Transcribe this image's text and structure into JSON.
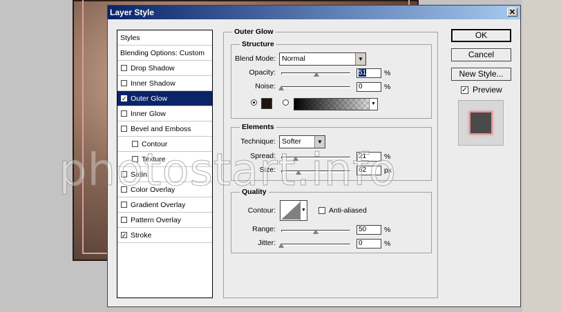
{
  "dialog": {
    "title": "Layer Style",
    "close_glyph": "✕"
  },
  "watermark": "photostart.info",
  "styles_list": [
    {
      "label": "Styles",
      "checkbox": false,
      "checked": false,
      "indent": 0,
      "selected": false
    },
    {
      "label": "Blending Options: Custom",
      "checkbox": false,
      "checked": false,
      "indent": 0,
      "selected": false
    },
    {
      "label": "Drop Shadow",
      "checkbox": true,
      "checked": false,
      "indent": 0,
      "selected": false
    },
    {
      "label": "Inner Shadow",
      "checkbox": true,
      "checked": false,
      "indent": 0,
      "selected": false
    },
    {
      "label": "Outer Glow",
      "checkbox": true,
      "checked": true,
      "indent": 0,
      "selected": true
    },
    {
      "label": "Inner Glow",
      "checkbox": true,
      "checked": false,
      "indent": 0,
      "selected": false
    },
    {
      "label": "Bevel and Emboss",
      "checkbox": true,
      "checked": false,
      "indent": 0,
      "selected": false
    },
    {
      "label": "Contour",
      "checkbox": true,
      "checked": false,
      "indent": 1,
      "selected": false
    },
    {
      "label": "Texture",
      "checkbox": true,
      "checked": false,
      "indent": 1,
      "selected": false
    },
    {
      "label": "Satin",
      "checkbox": true,
      "checked": false,
      "indent": 0,
      "selected": false
    },
    {
      "label": "Color Overlay",
      "checkbox": true,
      "checked": false,
      "indent": 0,
      "selected": false
    },
    {
      "label": "Gradient Overlay",
      "checkbox": true,
      "checked": false,
      "indent": 0,
      "selected": false
    },
    {
      "label": "Pattern Overlay",
      "checkbox": true,
      "checked": false,
      "indent": 0,
      "selected": false
    },
    {
      "label": "Stroke",
      "checkbox": true,
      "checked": true,
      "indent": 0,
      "selected": false
    }
  ],
  "outer_glow": {
    "title": "Outer Glow",
    "structure": {
      "title": "Structure",
      "blend_mode_label": "Blend Mode:",
      "blend_mode_value": "Normal",
      "opacity_label": "Opacity:",
      "opacity_value": "51",
      "noise_label": "Noise:",
      "noise_value": "0",
      "unit": "%",
      "glow_color": "#1e1410"
    },
    "elements": {
      "title": "Elements",
      "technique_label": "Technique:",
      "technique_value": "Softer",
      "spread_label": "Spread:",
      "spread_value": "21",
      "size_label": "Size:",
      "size_value": "62",
      "spread_unit": "%",
      "size_unit": "px"
    },
    "quality": {
      "title": "Quality",
      "contour_label": "Contour:",
      "antialiased_label": "Anti-aliased",
      "range_label": "Range:",
      "range_value": "50",
      "jitter_label": "Jitter:",
      "jitter_value": "0",
      "unit": "%"
    }
  },
  "buttons": {
    "ok": "OK",
    "cancel": "Cancel",
    "new_style": "New Style...",
    "preview_label": "Preview",
    "preview_checked": true
  },
  "colors": {
    "title_bar": "#0a246a",
    "selection": "#0a246a",
    "preview_fill": "#4a4a4a",
    "preview_glow": "#e89090"
  }
}
